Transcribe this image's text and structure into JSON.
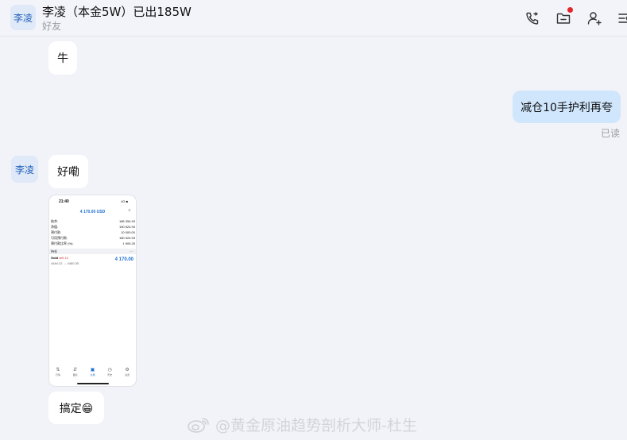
{
  "header": {
    "avatar_text": "李凌",
    "title": "李凌（本金5W）已出185W",
    "subtitle": "好友",
    "icons": [
      "phone-call-icon",
      "folder-icon",
      "add-friend-icon",
      "more-menu-icon"
    ],
    "notification_color": "#e6242b"
  },
  "messages": [
    {
      "id": "m1",
      "side": "left",
      "type": "text",
      "text": "牛"
    },
    {
      "id": "m2",
      "side": "right",
      "type": "text",
      "text": "减仓10手护利再夸",
      "status": "已读"
    },
    {
      "id": "m3",
      "side": "left",
      "type": "text",
      "avatar_text": "李凌",
      "text": "好嘞"
    },
    {
      "id": "m4",
      "side": "left",
      "type": "image"
    },
    {
      "id": "m5",
      "side": "left",
      "type": "text",
      "text": "搞定😁"
    }
  ],
  "screenshot": {
    "time": "21:40",
    "status": "4G ■",
    "balance": "4 170.00 USD",
    "rows": [
      {
        "label": "结余:",
        "value": "186 354.93"
      },
      {
        "label": "净值:",
        "value": "190 524.93"
      },
      {
        "label": "预付款:",
        "value": "10 000.00"
      },
      {
        "label": "可用预付款:",
        "value": "180 524.93"
      },
      {
        "label": "预付款比率 (%):",
        "value": "1 905.25"
      }
    ],
    "section_label": "持仓",
    "section_more": "···",
    "trade_symbol": "Gold",
    "trade_side": "sell 10",
    "trade_prices": "4484.22 → 4480.05",
    "trade_pnl": "4 170.00",
    "nav": [
      "行情",
      "图表",
      "交易",
      "历史",
      "设置"
    ]
  },
  "watermark": "@黄金原油趋势剖析大师-杜生",
  "colors": {
    "accent": "#1c6fd1",
    "my_bubble": "#cfe6fd",
    "background": "#f2f3f8"
  }
}
